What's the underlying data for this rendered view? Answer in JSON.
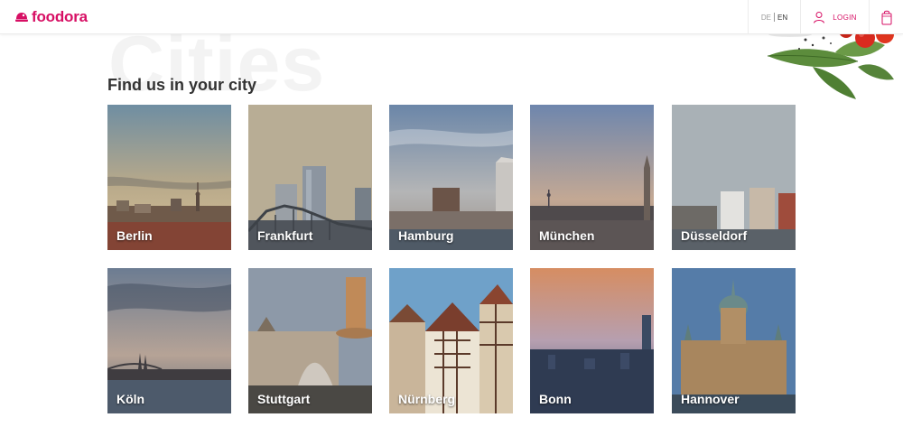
{
  "header": {
    "brand": "foodora",
    "languages": {
      "de": "DE",
      "en": "EN",
      "active": "EN"
    },
    "login": "LOGIN"
  },
  "page": {
    "background_title": "Cities",
    "heading": "Find us in your city"
  },
  "cities": [
    {
      "name": "Berlin"
    },
    {
      "name": "Frankfurt"
    },
    {
      "name": "Hamburg"
    },
    {
      "name": "München"
    },
    {
      "name": "Düsseldorf"
    },
    {
      "name": "Köln"
    },
    {
      "name": "Stuttgart"
    },
    {
      "name": "Nürnberg"
    },
    {
      "name": "Bonn"
    },
    {
      "name": "Hannover"
    }
  ],
  "colors": {
    "brand": "#d70f64"
  }
}
